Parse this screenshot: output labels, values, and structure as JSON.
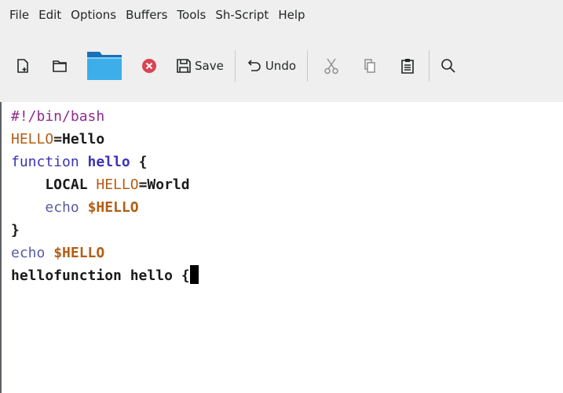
{
  "menubar": {
    "items": [
      "File",
      "Edit",
      "Options",
      "Buffers",
      "Tools",
      "Sh-Script",
      "Help"
    ]
  },
  "toolbar": {
    "save_label": "Save",
    "undo_label": "Undo"
  },
  "editor": {
    "lines": [
      [
        "#!/bin/bash"
      ],
      [
        "HELLO",
        "=Hello"
      ],
      [
        "function",
        " ",
        "hello",
        " {"
      ],
      [
        "    LOCAL ",
        "HELLO",
        "=World"
      ],
      [
        "    ",
        "echo",
        " ",
        "$HELLO"
      ],
      [
        "}"
      ],
      [
        "echo",
        " ",
        "$HELLO"
      ],
      [
        "hellofunction hello {"
      ]
    ]
  },
  "colors": {
    "comment": "#8e2c8e",
    "variable": "#b35e14",
    "keyword": "#3b33b3",
    "builtin": "#5a5aa3",
    "close_icon": "#da4453",
    "folder_icon": "#1d99f3"
  }
}
